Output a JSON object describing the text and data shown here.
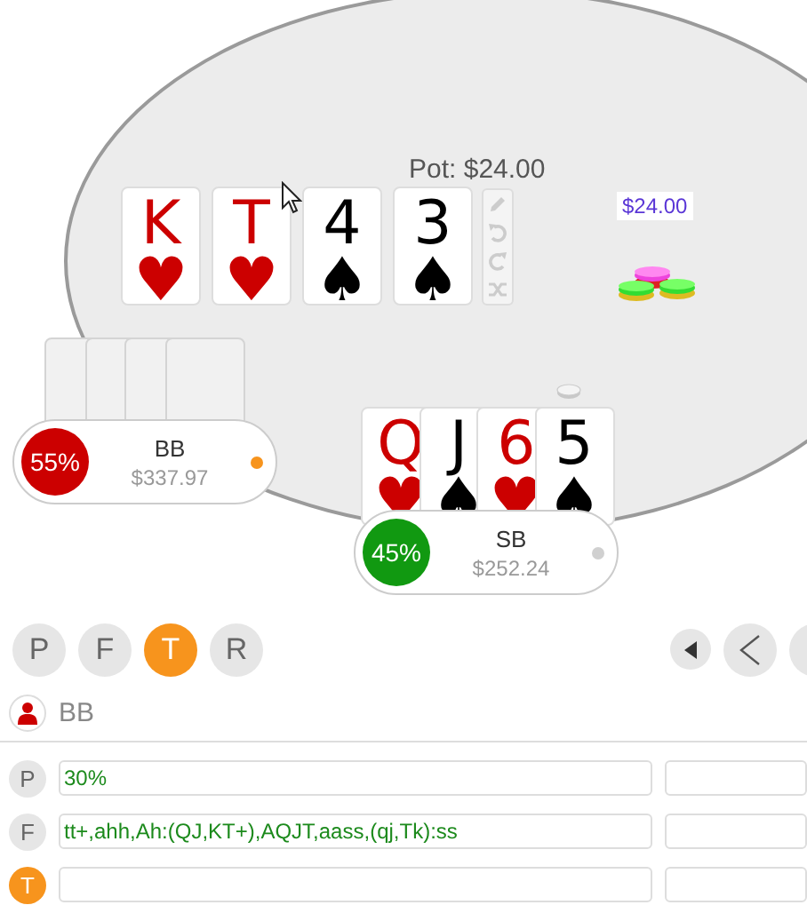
{
  "table": {
    "pot": "Pot: $24.00",
    "bet": "$24.00",
    "board": [
      {
        "rank": "K",
        "suit": "♥",
        "color": "#cc0000"
      },
      {
        "rank": "T",
        "suit": "♥",
        "color": "#cc0000"
      },
      {
        "rank": "4",
        "suit": "♠",
        "color": "#000000"
      },
      {
        "rank": "3",
        "suit": "♠",
        "color": "#000000"
      }
    ]
  },
  "players": [
    {
      "name": "BB",
      "stack": "$337.97",
      "equity": "55%",
      "color": "#cc0000",
      "to_act": true,
      "cards": [
        {
          "kind": "back"
        },
        {
          "kind": "back"
        },
        {
          "kind": "back"
        },
        {
          "kind": "back"
        }
      ]
    },
    {
      "name": "SB",
      "stack": "$252.24",
      "equity": "45%",
      "color": "#119911",
      "to_act": false,
      "cards": [
        {
          "kind": "face",
          "rank": "Q",
          "suit": "♥",
          "color": "#cc0000"
        },
        {
          "kind": "face",
          "rank": "J",
          "suit": "♠",
          "color": "#000000"
        },
        {
          "kind": "face",
          "rank": "6",
          "suit": "♥",
          "color": "#cc0000"
        },
        {
          "kind": "face",
          "rank": "5",
          "suit": "♠",
          "color": "#000000"
        }
      ]
    }
  ],
  "streets": [
    {
      "label": "P",
      "selected": false
    },
    {
      "label": "F",
      "selected": false
    },
    {
      "label": "T",
      "selected": true
    },
    {
      "label": "R",
      "selected": false
    }
  ],
  "range_panel": {
    "player": "BB",
    "rows": [
      {
        "street": "P",
        "value": "30%",
        "selected": false
      },
      {
        "street": "F",
        "value": "tt+,ahh,Ah:(QJ,KT+),AQJT,aass,(qj,Tk):ss",
        "selected": false
      },
      {
        "street": "T",
        "selected": true
      }
    ]
  }
}
